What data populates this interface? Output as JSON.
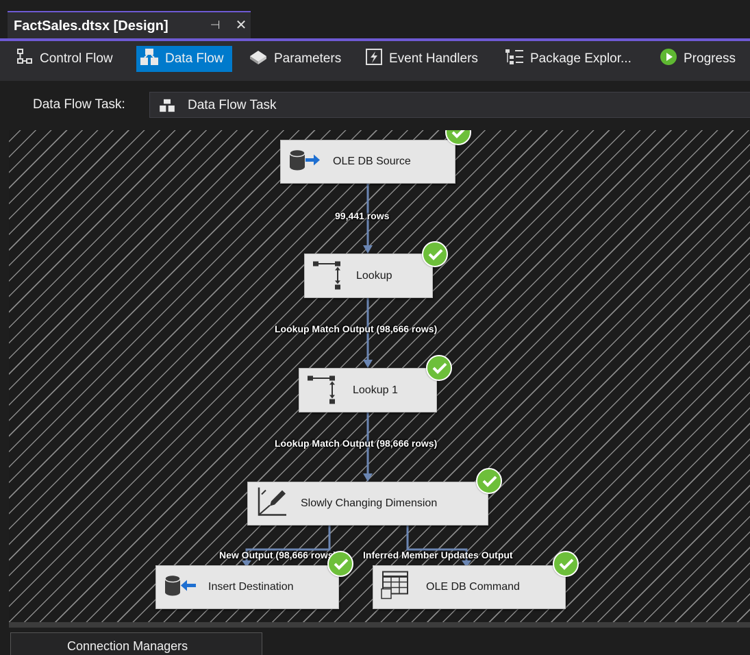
{
  "document_tab": {
    "title": "FactSales.dtsx [Design]",
    "pin_icon": "pin-icon",
    "close_icon": "close-icon",
    "accent_color": "#6e5ad4"
  },
  "designer_tabs": [
    {
      "label": "Control Flow",
      "icon": "control-flow-icon",
      "active": false
    },
    {
      "label": "Data Flow",
      "icon": "data-flow-icon",
      "active": true
    },
    {
      "label": "Parameters",
      "icon": "parameters-icon",
      "active": false
    },
    {
      "label": "Event Handlers",
      "icon": "event-handlers-icon",
      "active": false
    },
    {
      "label": "Package Explor...",
      "icon": "package-explorer-icon",
      "active": false
    },
    {
      "label": "Progress",
      "icon": "progress-icon",
      "active": false
    }
  ],
  "task_selector": {
    "label": "Data Flow Task:",
    "value": "Data Flow Task"
  },
  "components": {
    "ole_db_source": {
      "label": "OLE DB Source",
      "status": "success"
    },
    "lookup": {
      "label": "Lookup",
      "status": "success"
    },
    "lookup_1": {
      "label": "Lookup 1",
      "status": "success"
    },
    "scd": {
      "label": "Slowly Changing Dimension",
      "status": "success"
    },
    "insert_destination": {
      "label": "Insert Destination",
      "status": "success"
    },
    "ole_db_command": {
      "label": "OLE DB Command",
      "status": "success"
    }
  },
  "paths": {
    "source_to_lookup": "99,441 rows",
    "lookup_to_lookup1": "Lookup Match Output (98,666 rows)",
    "lookup1_to_scd": "Lookup Match Output (98,666 rows)",
    "scd_new_output": "New Output (98,666 rows)",
    "scd_inferred_output": "Inferred Member Updates Output"
  },
  "connection_managers": {
    "label": "Connection Managers"
  },
  "colors": {
    "active_tab": "#007acc",
    "success": "#6dbf3a",
    "path_line": "#6b86b3"
  }
}
